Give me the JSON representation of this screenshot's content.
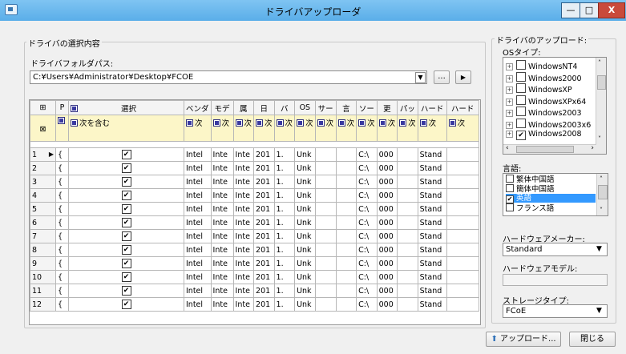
{
  "window": {
    "title": "ドライバアップローダ",
    "min_label": "—",
    "max_label": "□",
    "close_label": "X"
  },
  "left": {
    "group_label": "ドライバの選択内容",
    "folder_label": "ドライバフォルダパス:",
    "folder_value": "C:¥Users¥Administrator¥Desktop¥FCOE",
    "browse_label": "...",
    "go_label": "▶"
  },
  "grid": {
    "headers": [
      "P",
      "選択",
      "ベンダ",
      "モデ",
      "属",
      "日",
      "バ",
      "OS",
      "サー",
      "言",
      "ソー",
      "更",
      "パッ",
      "ハード",
      "ハード"
    ],
    "filter_select": "次を含む",
    "filters": [
      "次",
      "次",
      "次",
      "次",
      "次",
      "次",
      "次",
      "次",
      "次",
      "次",
      "次",
      "次",
      "次"
    ],
    "rows": [
      {
        "num": "1",
        "p": "{",
        "vendor": "Intel",
        "model": "Inte",
        "attr": "Inte",
        "date": "201",
        "ver": "1.",
        "os": "Unk",
        "src": "C:\\",
        "upd": "000",
        "hw": "Stand"
      },
      {
        "num": "2",
        "p": "{",
        "vendor": "Intel",
        "model": "Inte",
        "attr": "Inte",
        "date": "201",
        "ver": "1.",
        "os": "Unk",
        "src": "C:\\",
        "upd": "000",
        "hw": "Stand"
      },
      {
        "num": "3",
        "p": "{",
        "vendor": "Intel",
        "model": "Inte",
        "attr": "Inte",
        "date": "201",
        "ver": "1.",
        "os": "Unk",
        "src": "C:\\",
        "upd": "000",
        "hw": "Stand"
      },
      {
        "num": "4",
        "p": "{",
        "vendor": "Intel",
        "model": "Inte",
        "attr": "Inte",
        "date": "201",
        "ver": "1.",
        "os": "Unk",
        "src": "C:\\",
        "upd": "000",
        "hw": "Stand"
      },
      {
        "num": "5",
        "p": "{",
        "vendor": "Intel",
        "model": "Inte",
        "attr": "Inte",
        "date": "201",
        "ver": "1.",
        "os": "Unk",
        "src": "C:\\",
        "upd": "000",
        "hw": "Stand"
      },
      {
        "num": "6",
        "p": "{",
        "vendor": "Intel",
        "model": "Inte",
        "attr": "Inte",
        "date": "201",
        "ver": "1.",
        "os": "Unk",
        "src": "C:\\",
        "upd": "000",
        "hw": "Stand"
      },
      {
        "num": "7",
        "p": "{",
        "vendor": "Intel",
        "model": "Inte",
        "attr": "Inte",
        "date": "201",
        "ver": "1.",
        "os": "Unk",
        "src": "C:\\",
        "upd": "000",
        "hw": "Stand"
      },
      {
        "num": "8",
        "p": "{",
        "vendor": "Intel",
        "model": "Inte",
        "attr": "Inte",
        "date": "201",
        "ver": "1.",
        "os": "Unk",
        "src": "C:\\",
        "upd": "000",
        "hw": "Stand"
      },
      {
        "num": "9",
        "p": "{",
        "vendor": "Intel",
        "model": "Inte",
        "attr": "Inte",
        "date": "201",
        "ver": "1.",
        "os": "Unk",
        "src": "C:\\",
        "upd": "000",
        "hw": "Stand"
      },
      {
        "num": "10",
        "p": "{",
        "vendor": "Intel",
        "model": "Inte",
        "attr": "Inte",
        "date": "201",
        "ver": "1.",
        "os": "Unk",
        "src": "C:\\",
        "upd": "000",
        "hw": "Stand"
      },
      {
        "num": "11",
        "p": "{",
        "vendor": "Intel",
        "model": "Inte",
        "attr": "Inte",
        "date": "201",
        "ver": "1.",
        "os": "Unk",
        "src": "C:\\",
        "upd": "000",
        "hw": "Stand"
      },
      {
        "num": "12",
        "p": "{",
        "vendor": "Intel",
        "model": "Inte",
        "attr": "Inte",
        "date": "201",
        "ver": "1.",
        "os": "Unk",
        "src": "C:\\",
        "upd": "000",
        "hw": "Stand"
      }
    ]
  },
  "right": {
    "group_label": "ドライバのアップロード:",
    "os_label": "OSタイプ:",
    "os_items": [
      {
        "label": "WindowsNT4",
        "checked": false
      },
      {
        "label": "Windows2000",
        "checked": false
      },
      {
        "label": "WindowsXP",
        "checked": false
      },
      {
        "label": "WindowsXPx64",
        "checked": false
      },
      {
        "label": "Windows2003",
        "checked": false
      },
      {
        "label": "Windows2003x6",
        "checked": false
      },
      {
        "label": "Windows2008",
        "checked": true
      }
    ],
    "lang_label": "言語:",
    "lang_items": [
      {
        "label": "繁体中国語",
        "checked": false,
        "selected": false
      },
      {
        "label": "簡体中国語",
        "checked": false,
        "selected": false
      },
      {
        "label": "英語",
        "checked": true,
        "selected": true
      },
      {
        "label": "フランス語",
        "checked": false,
        "selected": false
      }
    ],
    "maker_label": "ハードウェアメーカー:",
    "maker_value": "Standard",
    "model_label": "ハードウェアモデル:",
    "model_value": "",
    "storage_label": "ストレージタイプ:",
    "storage_value": "FCoE"
  },
  "footer": {
    "upload_label": "アップロード...",
    "close_label": "閉じる"
  }
}
